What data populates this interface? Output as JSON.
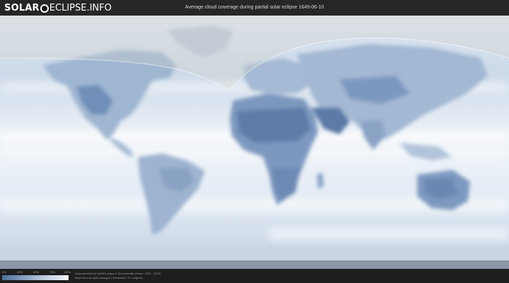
{
  "header": {
    "logo_left": "SOLAR",
    "logo_right": "ECLIPSE.INFO",
    "title": "Average cloud coverage during partial solar eclipse 1649-06-10"
  },
  "legend": {
    "labels": [
      "0%",
      "25%",
      "50%",
      "75%",
      "100%"
    ],
    "colors": [
      "#4d6f9a",
      "#89a3c3",
      "#c5d3e4",
      "#f2f5f9"
    ]
  },
  "footer": {
    "credit_line1": "Data provided by NASA's Aqua & Terra satellite (Years: 2000 - 2019)",
    "credit_line2": "https://neo.sci.gsfc.nasa.gov | Resolution: 0.1 degrees"
  },
  "colors": {
    "ocean_cloud": "#e8eff7",
    "land_clear": "#5f7faa",
    "eclipse_shadow": "#d9d6d0",
    "ice": "#f5f7fa"
  }
}
